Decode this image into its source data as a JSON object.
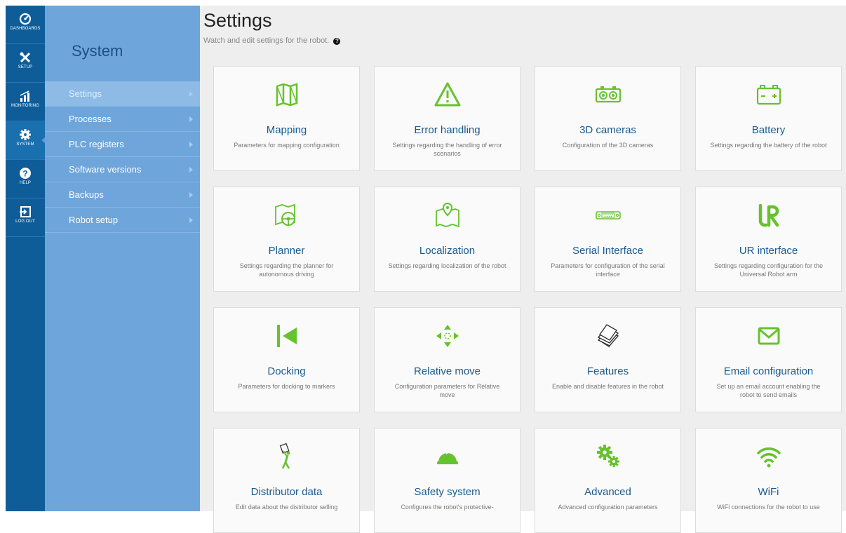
{
  "rail": {
    "items": [
      {
        "label": "DASHBOARDS",
        "icon": "dashboard-icon"
      },
      {
        "label": "SETUP",
        "icon": "tools-icon"
      },
      {
        "label": "MONITORING",
        "icon": "signal-bars-icon"
      },
      {
        "label": "SYSTEM",
        "icon": "gear-icon",
        "active": true
      },
      {
        "label": "HELP",
        "icon": "question-icon"
      },
      {
        "label": "LOG OUT",
        "icon": "logout-icon"
      }
    ]
  },
  "sub": {
    "title": "System",
    "items": [
      {
        "label": "Settings",
        "active": true
      },
      {
        "label": "Processes"
      },
      {
        "label": "PLC registers"
      },
      {
        "label": "Software versions"
      },
      {
        "label": "Backups"
      },
      {
        "label": "Robot setup"
      }
    ]
  },
  "main": {
    "title": "Settings",
    "subtitle": "Watch and edit settings for the robot.",
    "help_glyph": "?",
    "cards": [
      {
        "title": "Mapping",
        "desc": "Parameters for mapping configuration",
        "icon": "map-icon"
      },
      {
        "title": "Error handling",
        "desc": "Settings regarding the handling of error scenarios",
        "icon": "warning-icon"
      },
      {
        "title": "3D cameras",
        "desc": "Configuration of the 3D cameras",
        "icon": "camera-icon"
      },
      {
        "title": "Battery",
        "desc": "Settings regarding the battery of the robot",
        "icon": "battery-icon"
      },
      {
        "title": "Planner",
        "desc": "Settings regarding the planner for autonomous driving",
        "icon": "map-steering-icon"
      },
      {
        "title": "Localization",
        "desc": "Settings regarding localization of the robot",
        "icon": "map-pin-icon"
      },
      {
        "title": "Serial Interface",
        "desc": "Parameters for configuration of the serial interface",
        "icon": "serial-port-icon"
      },
      {
        "title": "UR interface",
        "desc": "Settings regarding configuration for the Universal Robot arm",
        "icon": "ur-logo-icon"
      },
      {
        "title": "Docking",
        "desc": "Parameters for docking to markers",
        "icon": "docking-icon"
      },
      {
        "title": "Relative move",
        "desc": "Configuration parameters for Relative move",
        "icon": "move-arrows-icon"
      },
      {
        "title": "Features",
        "desc": "Enable and disable features in the robot",
        "icon": "stack-icon"
      },
      {
        "title": "Email configuration",
        "desc": "Set up an email account enabling the robot to send emails",
        "icon": "envelope-icon"
      },
      {
        "title": "Distributor data",
        "desc": "Edit data about the distributor selling",
        "icon": "person-carry-icon"
      },
      {
        "title": "Safety system",
        "desc": "Configures the robot's protective-",
        "icon": "hardhat-icon"
      },
      {
        "title": "Advanced",
        "desc": "Advanced configuration parameters",
        "icon": "gears-icon"
      },
      {
        "title": "WiFi",
        "desc": "WiFi connections for the robot to use",
        "icon": "wifi-icon"
      }
    ]
  },
  "colors": {
    "accent_green": "#66c22e",
    "rail_blue": "#0e5d99",
    "submenu_blue": "#6ea5da",
    "title_blue": "#1a5a8f"
  }
}
